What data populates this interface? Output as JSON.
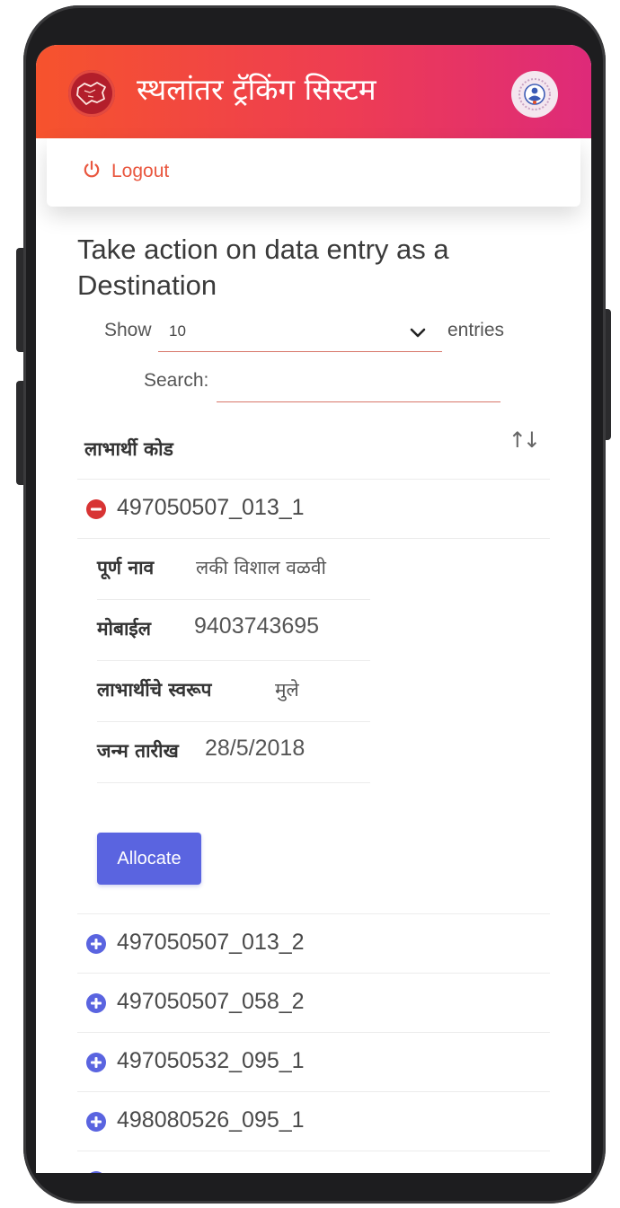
{
  "header": {
    "title": "स्थलांतर ट्रॅकिंग सिस्टम",
    "left_logo": "maharashtra-map-icon",
    "right_logo": "emblem-icon",
    "gradient_colors": [
      "#f6532d",
      "#ee3d52",
      "#de2a79"
    ]
  },
  "nav": {
    "logout_label": "Logout",
    "logout_icon": "power-icon",
    "accent_color": "#e9573f"
  },
  "main": {
    "heading": "Take action on data entry as a Destination",
    "length": {
      "show_label": "Show",
      "selected": "10",
      "entries_label": "entries"
    },
    "search": {
      "label": "Search:",
      "value": ""
    },
    "table": {
      "column_header": "लाभार्थी कोड",
      "sort_icon": "sort-arrows-icon",
      "rows": [
        {
          "code": "497050507_013_1",
          "expanded": true
        },
        {
          "code": "497050507_013_2",
          "expanded": false
        },
        {
          "code": "497050507_058_2",
          "expanded": false
        },
        {
          "code": "497050532_095_1",
          "expanded": false
        },
        {
          "code": "498080526_095_1",
          "expanded": false
        }
      ],
      "details": [
        {
          "key": "पूर्ण नाव",
          "value": "लकी विशाल वळवी"
        },
        {
          "key": "मोबाईल",
          "value": "9403743695"
        },
        {
          "key": "लाभार्थीचे स्वरूप",
          "value": "मुले"
        },
        {
          "key": "जन्म तारीख",
          "value": "28/5/2018"
        }
      ],
      "action_label": "Allocate",
      "action_color": "#5a64e0",
      "collapse_color": "#d83434",
      "expand_color": "#5a64e0"
    }
  }
}
